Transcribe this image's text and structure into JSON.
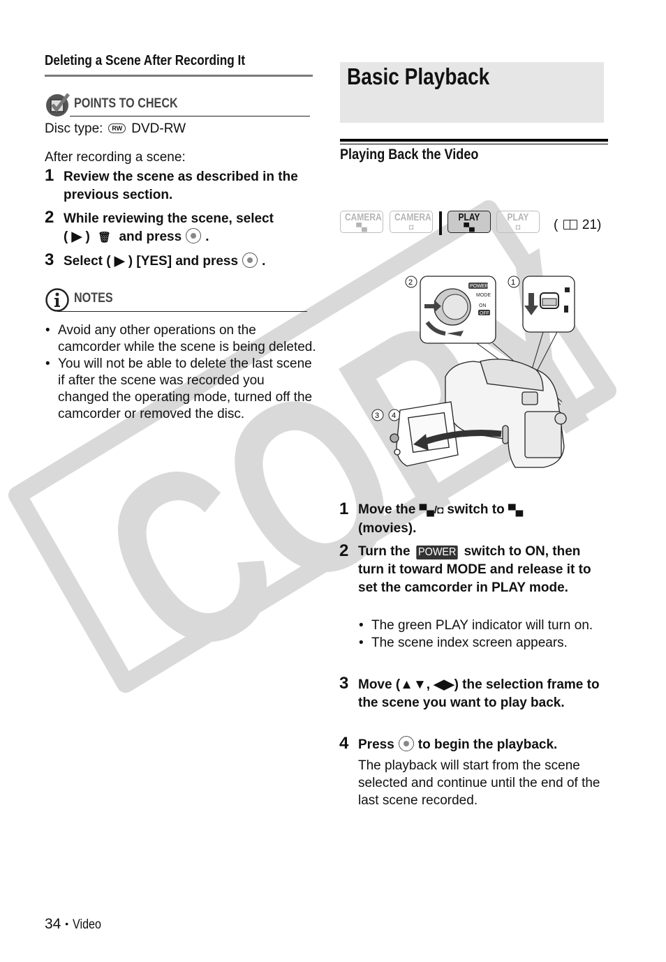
{
  "watermark": {
    "text": "COPY",
    "color": "#d9d9d9"
  },
  "left": {
    "section_title": "Deleting a Scene After Recording It",
    "points_to_check": {
      "icon": "checkbox-check-icon",
      "label": "POINTS TO CHECK",
      "disc_type_label": "Disc type:",
      "disc_badge": "RW",
      "disc_value": "DVD-RW"
    },
    "intro": "After recording a scene:",
    "steps": [
      {
        "num": "1",
        "text": "Review the scene as described in the previous section."
      },
      {
        "num": "2",
        "text_a": "While reviewing the scene, select",
        "text_b": "( ▶ )",
        "trash_icon": "🗑",
        "text_c": "and press",
        "text_d": "."
      },
      {
        "num": "3",
        "text_a": "Select ( ▶ ) [YES] and press",
        "text_b": "."
      }
    ],
    "notes": {
      "icon": "info-icon",
      "label": "NOTES",
      "items": [
        "Avoid any other operations on the camcorder while the scene is being deleted.",
        "You will not be able to delete the last scene if after the scene was recorded you changed the operating mode, turned off the camcorder or removed the disc."
      ]
    }
  },
  "right": {
    "title": "Basic Playback",
    "subtitle": "Playing Back the Video",
    "modes": [
      {
        "label": "CAMERA",
        "icon": "movie-icon",
        "glyph": "▀▄",
        "active": false
      },
      {
        "label": "CAMERA",
        "icon": "photo-icon",
        "glyph": "◘",
        "active": false
      },
      {
        "label": "PLAY",
        "icon": "movie-icon",
        "glyph": "▀▄",
        "active": true
      },
      {
        "label": "PLAY",
        "icon": "photo-icon",
        "glyph": "◘",
        "active": false
      }
    ],
    "page_ref": {
      "book_icon": "📖",
      "open": "(",
      "page": "21",
      "close": ")"
    },
    "illustration": {
      "callouts": [
        "①",
        "②",
        "③",
        "④"
      ],
      "power_label": "POWER",
      "mode_label": "MODE",
      "on_label": "ON",
      "off_label": "OFF"
    },
    "steps": [
      {
        "num": "1",
        "text_a": "Move the",
        "sym_a": "▀▄/◘",
        "text_b": "switch to",
        "sym_b": "▀▄",
        "text_c": "(movies)."
      },
      {
        "num": "2",
        "text_a": "Turn the",
        "power": "POWER",
        "text_b": "switch to ON, then turn it toward MODE and release it to set the camcorder in PLAY mode."
      },
      {
        "num": "3",
        "text": "Move (▲▼, ◀▶) the selection frame to the scene you want to play back."
      },
      {
        "num": "4",
        "text_a": "Press",
        "text_b": "to begin the playback.",
        "detail": "The playback will start from the scene selected and continue until the end of the last scene recorded."
      }
    ],
    "step2_bullets": [
      "The green PLAY indicator will turn on.",
      "The scene index screen appears."
    ]
  },
  "footer": {
    "page_number": "34",
    "separator": "•",
    "section": "Video"
  }
}
